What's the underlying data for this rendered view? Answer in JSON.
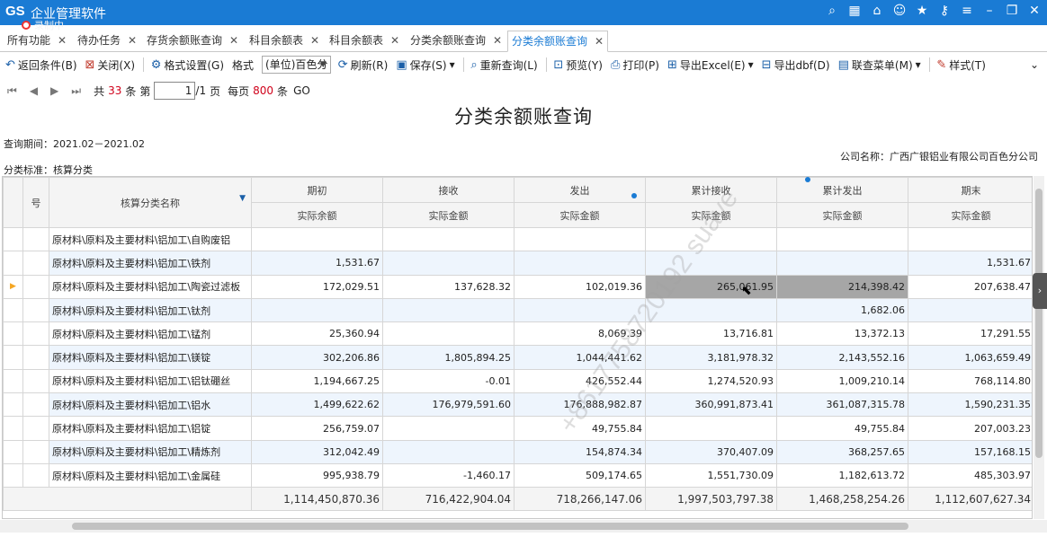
{
  "app": {
    "logo": "GS",
    "title": "企业管理软件",
    "recording": "录制中"
  },
  "tabs": [
    {
      "label": "所有功能"
    },
    {
      "label": "待办任务"
    },
    {
      "label": "存货余额账查询"
    },
    {
      "label": "科目余额表"
    },
    {
      "label": "科目余额表"
    },
    {
      "label": "分类余额账查询"
    },
    {
      "label": "分类余额账查询"
    }
  ],
  "toolbar": {
    "back": "返回条件(B)",
    "close": "关闭(X)",
    "format_setting": "格式设置(G)",
    "format_label": "格式",
    "format_value": "(单位)百色分",
    "refresh": "刷新(R)",
    "save": "保存(S)",
    "requery": "重新查询(L)",
    "preview": "预览(Y)",
    "print": "打印(P)",
    "export_excel": "导出Excel(E)",
    "export_dbf": "导出dbf(D)",
    "linked_menu": "联查菜单(M)",
    "style": "样式(T)"
  },
  "pager": {
    "total_prefix": "共",
    "total": "33",
    "rows_unit": "条",
    "page_prefix": "第",
    "current": "1",
    "pages": "/1",
    "page_unit": "页",
    "per_page_prefix": "每页",
    "per_page": "800",
    "per_page_unit": "条",
    "go": "GO"
  },
  "report": {
    "title": "分类余额账查询",
    "period": "查询期间：2021.02－2021.02",
    "company": "公司名称：广西广银铝业有限公司百色分公司",
    "class_std": "分类标准：核算分类"
  },
  "table": {
    "col_rownum": "号",
    "col_name": "核算分类名称",
    "groups": [
      "期初",
      "接收",
      "发出",
      "累计接收",
      "累计发出",
      "期末"
    ],
    "subheaders": [
      "实际余额",
      "实际金额",
      "实际金额",
      "实际金额",
      "实际金额",
      "实际金额"
    ],
    "rows": [
      {
        "name": "原材料\\原料及主要材料\\铝加工\\自购废铝",
        "v": [
          "",
          "",
          "",
          "",
          "",
          ""
        ]
      },
      {
        "name": "原材料\\原料及主要材料\\铝加工\\铁剂",
        "v": [
          "1,531.67",
          "",
          "",
          "",
          "",
          "1,531.67"
        ]
      },
      {
        "name": "原材料\\原料及主要材料\\铝加工\\陶瓷过滤板",
        "v": [
          "172,029.51",
          "137,628.32",
          "102,019.36",
          "265,061.95",
          "214,398.42",
          "207,638.47"
        ]
      },
      {
        "name": "原材料\\原料及主要材料\\铝加工\\钛剂",
        "v": [
          "",
          "",
          "",
          "",
          "1,682.06",
          ""
        ]
      },
      {
        "name": "原材料\\原料及主要材料\\铝加工\\锰剂",
        "v": [
          "25,360.94",
          "",
          "8,069.39",
          "13,716.81",
          "13,372.13",
          "17,291.55"
        ]
      },
      {
        "name": "原材料\\原料及主要材料\\铝加工\\镁锭",
        "v": [
          "302,206.86",
          "1,805,894.25",
          "1,044,441.62",
          "3,181,978.32",
          "2,143,552.16",
          "1,063,659.49"
        ]
      },
      {
        "name": "原材料\\原料及主要材料\\铝加工\\铝钛硼丝",
        "v": [
          "1,194,667.25",
          "-0.01",
          "426,552.44",
          "1,274,520.93",
          "1,009,210.14",
          "768,114.80"
        ]
      },
      {
        "name": "原材料\\原料及主要材料\\铝加工\\铝水",
        "v": [
          "1,499,622.62",
          "176,979,591.60",
          "176,888,982.87",
          "360,991,873.41",
          "361,087,315.78",
          "1,590,231.35"
        ]
      },
      {
        "name": "原材料\\原料及主要材料\\铝加工\\铝锭",
        "v": [
          "256,759.07",
          "",
          "49,755.84",
          "",
          "49,755.84",
          "207,003.23"
        ]
      },
      {
        "name": "原材料\\原料及主要材料\\铝加工\\精炼剂",
        "v": [
          "312,042.49",
          "",
          "154,874.34",
          "370,407.09",
          "368,257.65",
          "157,168.15"
        ]
      },
      {
        "name": "原材料\\原料及主要材料\\铝加工\\金属硅",
        "v": [
          "995,938.79",
          "-1,460.17",
          "509,174.65",
          "1,551,730.09",
          "1,182,613.72",
          "485,303.97"
        ]
      }
    ],
    "totals": [
      "1,114,450,870.36",
      "716,422,904.04",
      "718,266,147.06",
      "1,997,503,797.38",
      "1,468,258,254.26",
      "1,112,607,627.34"
    ]
  },
  "watermark": "+8617758720192 suave"
}
